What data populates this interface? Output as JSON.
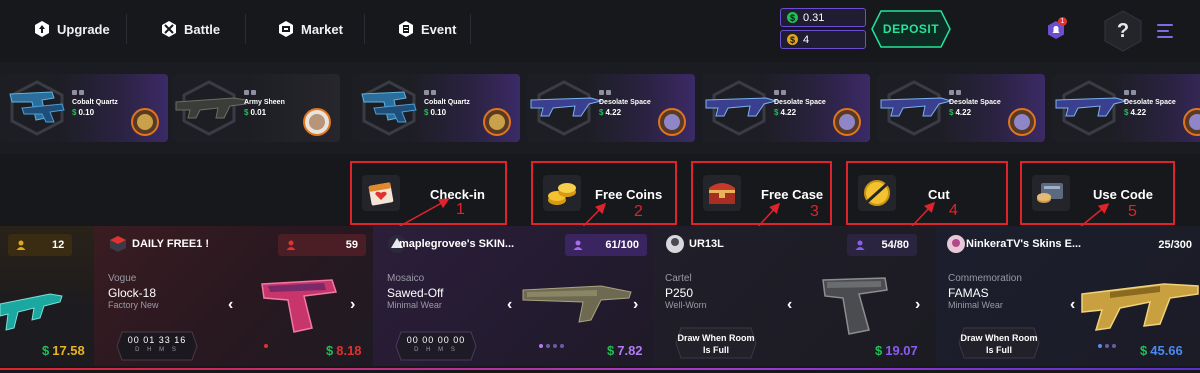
{
  "nav": {
    "items": [
      {
        "label": "Upgrade",
        "icon": "upgrade-icon"
      },
      {
        "label": "Battle",
        "icon": "battle-icon"
      },
      {
        "label": "Market",
        "icon": "market-icon"
      },
      {
        "label": "Event",
        "icon": "event-icon"
      }
    ]
  },
  "wallet": {
    "balance_symbol": "$",
    "balance": "0.31",
    "coins_symbol": "$",
    "coins": "4",
    "deposit_label": "DEPOSIT"
  },
  "notifications": {
    "count": "1"
  },
  "help_label": "?",
  "ticker": [
    {
      "name": "Cobalt Quartz",
      "price": "0.10",
      "currency": "$"
    },
    {
      "name": "Army Sheen",
      "price": "0.01",
      "currency": "$"
    },
    {
      "name": "Cobalt Quartz",
      "price": "0.10",
      "currency": "$"
    },
    {
      "name": "Desolate Space",
      "price": "4.22",
      "currency": "$"
    },
    {
      "name": "Desolate Space",
      "price": "4.22",
      "currency": "$"
    },
    {
      "name": "Desolate Space",
      "price": "4.22",
      "currency": "$"
    },
    {
      "name": "Desolate Space",
      "price": "4.22",
      "currency": "$"
    }
  ],
  "bonuses": [
    {
      "label": "Check-in",
      "number": "1",
      "icon": "calendar-icon"
    },
    {
      "label": "Free Coins",
      "number": "2",
      "icon": "coins-icon"
    },
    {
      "label": "Free Case",
      "number": "3",
      "icon": "chest-icon"
    },
    {
      "label": "Cut",
      "number": "4",
      "icon": "cut-coin-icon"
    },
    {
      "label": "Use Code",
      "number": "5",
      "icon": "code-icon"
    }
  ],
  "giveaways": {
    "card0": {
      "count": "12",
      "price": "17.58",
      "currency": "$"
    },
    "card1": {
      "title": "DAILY FREE1 !",
      "count": "59",
      "collection": "Vogue",
      "item": "Glock-18",
      "wear": "Factory New",
      "timer": "00 01 33 16",
      "timer_units": "D H M S",
      "price": "8.18",
      "currency": "$"
    },
    "card2": {
      "title": "maplegrovee's SKIN...",
      "count": "61/100",
      "collection": "Mosaico",
      "item": "Sawed-Off",
      "wear": "Minimal Wear",
      "timer": "00 00 00 00",
      "timer_units": "D H M S",
      "price": "7.82",
      "currency": "$"
    },
    "card3": {
      "title": "UR13L",
      "count": "54/80",
      "collection": "Cartel",
      "item": "P250",
      "wear": "Well-Worn",
      "draw_text": "Draw When Room Is Full",
      "price": "19.07",
      "currency": "$"
    },
    "card4": {
      "title": "NinkeraTV's Skins E...",
      "count": "25/300",
      "collection": "Commemoration",
      "item": "FAMAS",
      "wear": "Minimal Wear",
      "draw_text": "Draw When Room Is Full",
      "price": "45.66",
      "currency": "$"
    }
  },
  "colors": {
    "accent": "#6c4ed1",
    "money": "#1fbf55",
    "annotation": "#e0232b",
    "deposit": "#27e39a"
  }
}
